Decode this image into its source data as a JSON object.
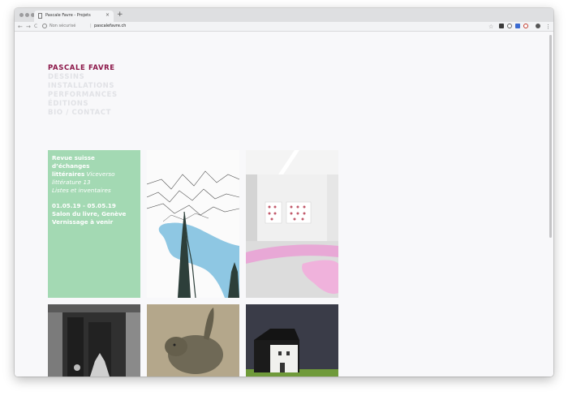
{
  "browser": {
    "tab_title": "Pascale Favre - Projets",
    "tab_close": "×",
    "new_tab": "+",
    "back": "←",
    "forward": "→",
    "reload": "C",
    "security_label": "Non sécurisé",
    "url_separator": "|",
    "url": "pascalefavre.ch",
    "bookmark": "☆",
    "menu": "⋮"
  },
  "site": {
    "brand": "PASCALE FAVRE",
    "menu": [
      "DESSINS",
      "INSTALLATIONS",
      "PERFORMANCES",
      "ÉDITIONS",
      "BIO / CONTACT"
    ]
  },
  "news": {
    "line1": "Revue suisse",
    "line2": "d’échanges",
    "line3_bold": "littéraires",
    "line3_italic": " Viceverso",
    "line4_italic": "littérature 13",
    "line5_italic": "Listes et inventaires",
    "dates": "01.05.19 - 05.05.19",
    "venue": "Salon du livre, Genève",
    "vernissage": "Vernissage à venir"
  },
  "colors": {
    "brand": "#8b1648",
    "menu_inactive": "#e1e2e6",
    "news_tile": "#a3d9b3"
  },
  "icons": [
    "document-icon",
    "info-icon",
    "star-icon",
    "extension-icons",
    "account-icon",
    "menu-icon"
  ]
}
